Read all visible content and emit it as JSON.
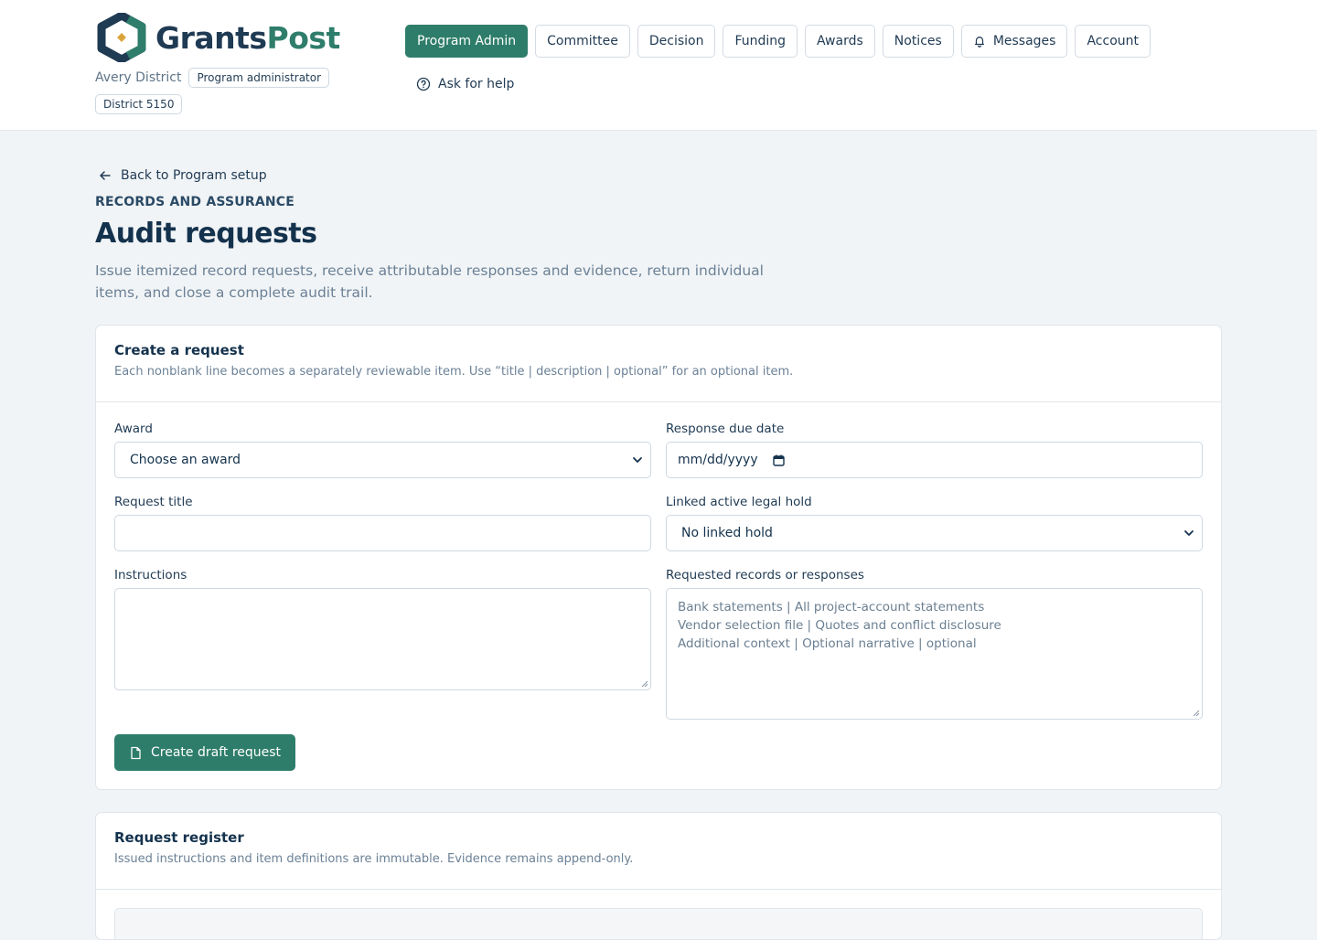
{
  "brand": {
    "name_part1": "Grants",
    "name_part2": "Post"
  },
  "org": {
    "name": "Avery District",
    "role": "Program administrator",
    "district": "District 5150"
  },
  "nav": {
    "items": [
      {
        "label": "Program Admin",
        "active": true
      },
      {
        "label": "Committee"
      },
      {
        "label": "Decision"
      },
      {
        "label": "Funding"
      },
      {
        "label": "Awards"
      },
      {
        "label": "Notices"
      },
      {
        "label": "Messages",
        "icon": "bell-icon"
      },
      {
        "label": "Account"
      }
    ],
    "help_label": "Ask for help"
  },
  "page": {
    "back_label": "Back to Program setup",
    "eyebrow": "RECORDS AND ASSURANCE",
    "title": "Audit requests",
    "description": "Issue itemized record requests, receive attributable responses and evidence, return individual items, and close a complete audit trail."
  },
  "create": {
    "title": "Create a request",
    "subtitle": "Each nonblank line becomes a separately reviewable item. Use “title | description | optional” for an optional item.",
    "award_label": "Award",
    "award_value": "Choose an award",
    "due_label": "Response due date",
    "due_value": "mm/dd/yyyy",
    "title_label": "Request title",
    "title_value": "",
    "hold_label": "Linked active legal hold",
    "hold_value": "No linked hold",
    "instructions_label": "Instructions",
    "instructions_value": "",
    "records_label": "Requested records or responses",
    "records_placeholder": "Bank statements | All project-account statements\nVendor selection file | Quotes and conflict disclosure\nAdditional context | Optional narrative | optional",
    "submit_label": "Create draft request"
  },
  "register": {
    "title": "Request register",
    "subtitle": "Issued instructions and item definitions are immutable. Evidence remains append-only."
  },
  "colors": {
    "primary": "#2e7d6a",
    "navy": "#14324d",
    "background": "#f1f4f6"
  }
}
